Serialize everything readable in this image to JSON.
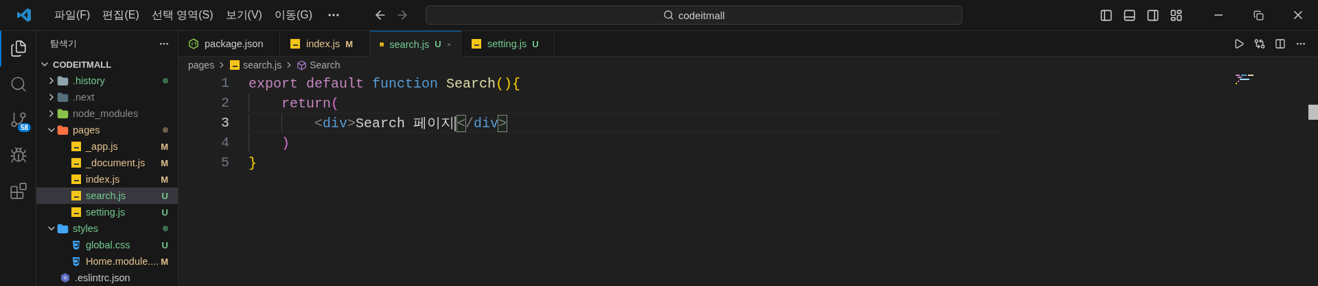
{
  "menu": [
    {
      "label": "파일(F)"
    },
    {
      "label": "편집(E)"
    },
    {
      "label": "선택 영역(S)"
    },
    {
      "label": "보기(V)"
    },
    {
      "label": "이동(G)"
    }
  ],
  "command_center": {
    "value": "codeitmall"
  },
  "activity_bar": [
    {
      "kind": "explorer",
      "selected": true
    },
    {
      "kind": "search",
      "selected": false
    },
    {
      "kind": "scm",
      "selected": false,
      "badge": "58"
    },
    {
      "kind": "debug",
      "selected": false
    },
    {
      "kind": "extensions",
      "selected": false
    }
  ],
  "explorer": {
    "title": "탐색기",
    "root": {
      "label": "CODEITMALL",
      "expanded": true,
      "children": [
        {
          "label": ".history",
          "kind": "folder",
          "color": "#73c991",
          "dot": {
            "color": "#3c6e4e"
          },
          "expanded": false,
          "selected": false
        },
        {
          "label": ".next",
          "kind": "nextfolder",
          "color": "#8c8c8c",
          "expanded": false,
          "selected": false
        },
        {
          "label": "node_modules",
          "kind": "nodefolder",
          "color": "#8c8c8c",
          "expanded": false,
          "selected": false
        },
        {
          "label": "pages",
          "kind": "pagesfolder",
          "color": "#e2c08d",
          "dot": {
            "color": "#6e5e48"
          },
          "expanded": true,
          "selected": false,
          "children": [
            {
              "label": "_app.js",
              "kind": "js",
              "color": "#e2c08d",
              "badge": "M",
              "selected": false
            },
            {
              "label": "_document.js",
              "kind": "js",
              "color": "#e2c08d",
              "badge": "M",
              "selected": false
            },
            {
              "label": "index.js",
              "kind": "js",
              "color": "#e2c08d",
              "badge": "M",
              "selected": false
            },
            {
              "label": "search.js",
              "kind": "js",
              "color": "#73c991",
              "badge": "U",
              "selected": true
            },
            {
              "label": "setting.js",
              "kind": "js",
              "color": "#73c991",
              "badge": "U",
              "selected": false
            }
          ]
        },
        {
          "label": "styles",
          "kind": "stylesfolder",
          "color": "#73c991",
          "dot": {
            "color": "#3c6e4e"
          },
          "expanded": true,
          "selected": false,
          "children": [
            {
              "label": "global.css",
              "kind": "css",
              "color": "#73c991",
              "badge": "U",
              "selected": false
            },
            {
              "label": "Home.module....",
              "kind": "css",
              "color": "#e2c08d",
              "badge": "M",
              "selected": false
            }
          ]
        },
        {
          "label": ".eslintrc.json",
          "kind": "eslint",
          "color": "#cccccc",
          "selected": false
        }
      ]
    }
  },
  "tabs": [
    {
      "label": "package.json",
      "kind": "json",
      "color": "#cccccc",
      "selected": false
    },
    {
      "label": "index.js",
      "kind": "js",
      "color": "#e2c08d",
      "badge": "M",
      "selected": false
    },
    {
      "label": "search.js",
      "kind": "js",
      "color": "#73c991",
      "badge": "U",
      "selected": true
    },
    {
      "label": "setting.js",
      "kind": "js",
      "color": "#73c991",
      "badge": "U",
      "selected": false
    }
  ],
  "breadcrumbs": [
    {
      "label": "pages",
      "kind": "folder"
    },
    {
      "label": "search.js",
      "kind": "js"
    },
    {
      "label": "Search",
      "kind": "symbol"
    }
  ],
  "code": [
    {
      "number": "1",
      "current": false,
      "tokens": [
        {
          "text": "export",
          "kind": "control"
        },
        {
          "text": "default",
          "kind": "control",
          "spaced": true
        },
        {
          "text": "function",
          "kind": "storage",
          "spaced": true
        },
        {
          "text": "Search",
          "kind": "function",
          "spaced": true
        },
        {
          "text": "(){",
          "kind": "bracket1"
        }
      ],
      "children": [
        {
          "number": "2",
          "current": false,
          "tokens": [
            {
              "text": "return",
              "kind": "control"
            },
            {
              "text": "(",
              "kind": "bracket2"
            }
          ],
          "children": [
            {
              "number": "3",
              "current": true,
              "tokens": [
                {
                  "text": "<",
                  "kind": "tagpunct"
                },
                {
                  "text": "div",
                  "kind": "tag"
                },
                {
                  "text": ">",
                  "kind": "tagpunct"
                },
                {
                  "text": "Search 페이지",
                  "kind": "text"
                },
                {
                  "text": "<",
                  "kind": "tagpunct",
                  "matched": true,
                  "caret": true
                },
                {
                  "text": "/",
                  "kind": "tagpunct"
                },
                {
                  "text": "div",
                  "kind": "tag"
                },
                {
                  "text": ">",
                  "kind": "tagpunct",
                  "matched": true
                }
              ]
            }
          ]
        },
        {
          "number": "4",
          "current": false,
          "tokens": [
            {
              "text": ")",
              "kind": "bracket2"
            }
          ]
        }
      ]
    },
    {
      "number": "5",
      "current": false,
      "tokens": [
        {
          "text": "}",
          "kind": "bracket1"
        }
      ]
    }
  ]
}
